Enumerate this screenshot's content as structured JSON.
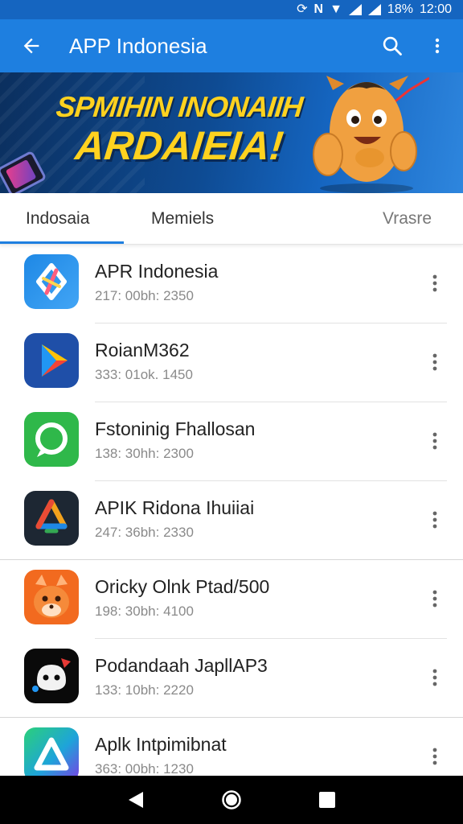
{
  "status_bar": {
    "battery": "18%",
    "time": "12:00"
  },
  "app_bar": {
    "title": "APP Indonesia",
    "back_icon": "arrow-back-icon",
    "search_icon": "search-icon",
    "more_icon": "more-vert-icon"
  },
  "banner": {
    "line1": "SPMIHIN INONAIIH",
    "line2": "ARDAIEIA!"
  },
  "tabs": [
    {
      "label": "Indosaia",
      "selected": true
    },
    {
      "label": "Memiels",
      "selected": false
    },
    {
      "label": "Vrasre",
      "selected": false
    }
  ],
  "apps": [
    {
      "name": "APR Indonesia",
      "meta": "217: 00bh: 2350"
    },
    {
      "name": "RoianM362",
      "meta": "333: 01ok. 1450"
    },
    {
      "name": "Fstoninig Fhallosan",
      "meta": "138: 30hh: 2300"
    },
    {
      "name": "APIK Ridona Ihuiiai",
      "meta": "247: 36bh: 2330"
    },
    {
      "name": "Oricky Olnk Ptad/500",
      "meta": "198: 30bh: 4100"
    },
    {
      "name": "Podandaah JapllAP3",
      "meta": "133: 10bh: 2220"
    },
    {
      "name": "Aplk Intpimibnat",
      "meta": "363: 00bh: 1230"
    }
  ],
  "colors": {
    "primary": "#1e7fe0",
    "status_bar": "#1565c0",
    "banner_text": "#ffd21f"
  }
}
